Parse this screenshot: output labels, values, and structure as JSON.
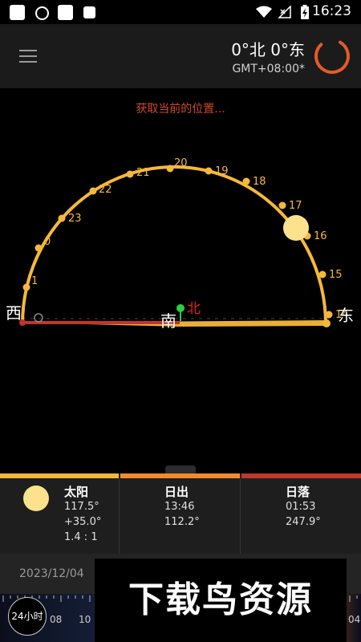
{
  "status": {
    "time": "16:23"
  },
  "header": {
    "coordinates": "0°北  0°东",
    "timezone": "GMT+08:00*"
  },
  "message": "获取当前的位置...",
  "compass": {
    "west": "西",
    "east": "东",
    "south": "南",
    "north": "北"
  },
  "hour_labels": [
    "1",
    "0",
    "23",
    "22",
    "21",
    "20",
    "19",
    "18",
    "17",
    "16",
    "15",
    "14"
  ],
  "info": {
    "sun": {
      "title": "太阳",
      "azimuth": "117.5°",
      "altitude": "+35.0°",
      "ratio": "1.4 : 1"
    },
    "sunrise": {
      "title": "日出",
      "time": "13:46",
      "azimuth": "112.2°"
    },
    "sunset": {
      "title": "日落",
      "time": "01:53",
      "azimuth": "247.9°"
    }
  },
  "date": "2023/12/04",
  "timeline": {
    "button": "24小时",
    "ticks": [
      "08",
      "10",
      "04"
    ]
  },
  "watermark": "下载鸟资源",
  "colors": {
    "orbit": "#f6b83a",
    "sun": "#fce28c",
    "north": "#e02020",
    "marker": "#2ecc40",
    "bar_sun": "#f5b73a",
    "bar_sunrise": "#f08c2c",
    "bar_sunset": "#c0392b"
  }
}
